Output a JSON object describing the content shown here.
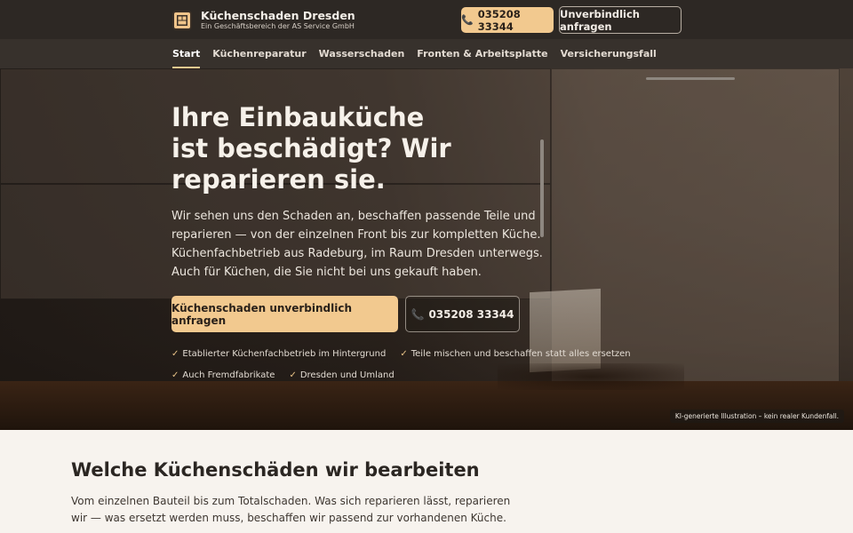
{
  "header": {
    "brand_name": "Küchenschaden Dresden",
    "brand_sub": "Ein Geschäftsbereich der AS Service GmbH",
    "phone_label": "035208 33344",
    "inquiry_label": "Unverbindlich anfragen"
  },
  "nav": {
    "items": [
      {
        "label": "Start",
        "active": true
      },
      {
        "label": "Küchenreparatur"
      },
      {
        "label": "Wasserschaden"
      },
      {
        "label": "Fronten & Arbeitsplatte"
      },
      {
        "label": "Versicherungsfall"
      }
    ]
  },
  "hero": {
    "title": "Ihre Einbauküche ist beschädigt? Wir reparieren sie.",
    "text": "Wir sehen uns den Schaden an, beschaffen passende Teile und reparieren — von der einzelnen Front bis zur kompletten Küche. Küchenfachbetrieb aus Radeburg, im Raum Dresden unterwegs. Auch für Küchen, die Sie nicht bei uns gekauft haben.",
    "cta_primary": "Küchenschaden unverbindlich anfragen",
    "cta_phone": "035208 33344",
    "checks": [
      "Etablierter Küchenfachbetrieb im Hintergrund",
      "Teile mischen und beschaffen statt alles ersetzen",
      "Auch Fremdfabrikate",
      "Dresden und Umland"
    ],
    "ai_note": "KI-generierte Illustration – kein realer Kundenfall."
  },
  "section": {
    "title": "Welche Küchenschäden wir bearbeiten",
    "text": "Vom einzelnen Bauteil bis zum Totalschaden. Was sich reparieren lässt, reparieren wir — was ersetzt werden muss, beschaffen wir passend zur vorhandenen Küche."
  },
  "colors": {
    "accent": "#f2c98f",
    "header_bg": "#2d2824",
    "nav_bg": "#37312c",
    "page_bg": "#f7f3ee"
  },
  "icons": {
    "phone": "phone-icon",
    "check": "check-icon",
    "logo": "kitchen-logo-icon"
  }
}
